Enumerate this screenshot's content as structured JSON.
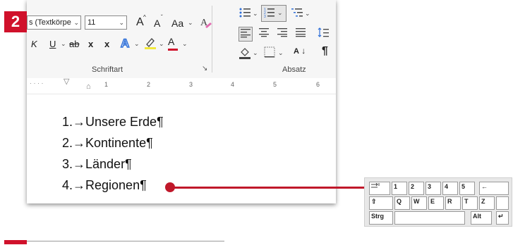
{
  "step": "2",
  "ribbon": {
    "font_name": "s (Textkörpe",
    "font_size": "11",
    "grow_font": "A",
    "shrink_font": "A",
    "change_case": "Aa",
    "italic": "K",
    "underline": "U",
    "strikethrough": "ab",
    "subscript": "x",
    "superscript": "x",
    "font_color": "A",
    "font_group_label": "Schriftart",
    "paragraph_group_label": "Absatz",
    "sort": "A",
    "pilcrow": "¶"
  },
  "ruler": {
    "ticks": [
      "1",
      "2",
      "3",
      "4",
      "5",
      "6"
    ]
  },
  "document": {
    "lines": [
      "1.→Unsere Erde¶",
      "2.→Kontinente¶",
      "3.→Länder¶",
      "4.→Regionen¶"
    ]
  },
  "keyboard": {
    "row1": [
      "",
      "1",
      "2",
      "3",
      "4",
      "5",
      "←"
    ],
    "row2": [
      "⇧",
      "Q",
      "W",
      "E",
      "R",
      "T",
      "Z"
    ],
    "row3": [
      "Strg",
      "",
      "Alt",
      "↵"
    ]
  },
  "colors": {
    "accent": "#d0112b",
    "callout": "#c0182a"
  }
}
